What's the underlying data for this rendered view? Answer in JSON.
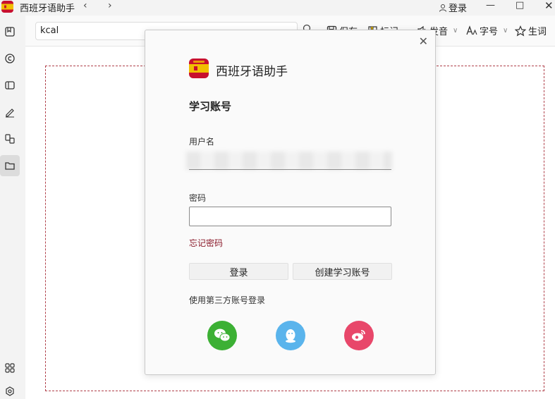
{
  "titlebar": {
    "app_title": "西班牙语助手",
    "login_label": "登录"
  },
  "toolbar": {
    "search_value": "kcal",
    "tools": [
      {
        "label": "保存",
        "icon": "save-icon"
      },
      {
        "label": "标记",
        "icon": "bookmark-icon"
      },
      {
        "label": "发音",
        "icon": "speaker-icon"
      },
      {
        "label": "字号",
        "icon": "font-size-icon"
      },
      {
        "label": "生词",
        "icon": "star-icon"
      }
    ]
  },
  "sidebar": {
    "items": [
      {
        "icon": "bookmark-square-icon"
      },
      {
        "icon": "copyright-icon"
      },
      {
        "icon": "book-icon"
      },
      {
        "icon": "pen-icon"
      },
      {
        "icon": "translate-icon"
      },
      {
        "icon": "folder-icon",
        "active": true
      }
    ],
    "bottom": [
      {
        "icon": "apps-grid-icon"
      },
      {
        "icon": "settings-icon"
      }
    ]
  },
  "modal": {
    "brand_name": "西班牙语助手",
    "section_title": "学习账号",
    "username_label": "用户名",
    "password_label": "密码",
    "forgot_label": "忘记密码",
    "login_button": "登录",
    "create_button": "创建学习账号",
    "third_party_title": "使用第三方账号登录",
    "social": [
      {
        "name": "wechat",
        "color": "#3cb034"
      },
      {
        "name": "qq",
        "color": "#5ab4ec"
      },
      {
        "name": "weibo",
        "color": "#e8476a"
      }
    ]
  },
  "colors": {
    "accent": "#8b1a2a",
    "dashed_border": "#b0404a",
    "flag_red": "#c8102e",
    "flag_yellow": "#f1bf00"
  }
}
